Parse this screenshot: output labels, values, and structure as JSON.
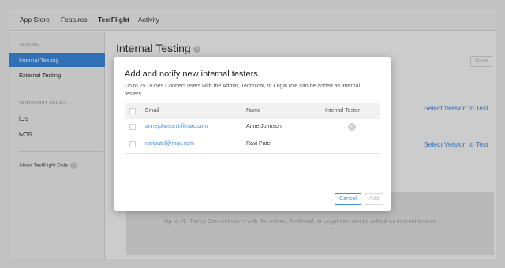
{
  "topnav": {
    "tabs": [
      "App Store",
      "Features",
      "TestFlight",
      "Activity"
    ],
    "active_tab": "TestFlight"
  },
  "sidebar": {
    "testing_header": "TESTING",
    "items": [
      "Internal Testing",
      "External Testing"
    ],
    "builds_header": "TESTFLIGHT BUILDS",
    "platforms": [
      "iOS",
      "tvOS"
    ],
    "about": "About TestFlight Data",
    "help_glyph": "?"
  },
  "main": {
    "title": "Internal Testing",
    "help_glyph": "?",
    "save_label": "Save",
    "select_version_ios": "Select Version to Test",
    "select_version_tvos": "Select Version to Test",
    "empty_message": "Up to 25 iTunes Connect users with the Admin, Technical, or Legal role can be added as internal testers."
  },
  "modal": {
    "title": "Add and notify new internal testers.",
    "description": "Up to 25 iTunes Connect users with the Admin, Technical, or Legal role can be added as internal testers.",
    "columns": {
      "email": "Email",
      "name": "Name",
      "internal_tester": "Internal Tester"
    },
    "rows": [
      {
        "email": "annejohnson1@mac.com",
        "name": "Anne Johnson",
        "internal_tester": true
      },
      {
        "email": "ravipatel@mac.com",
        "name": "Ravi Patel",
        "internal_tester": false
      }
    ],
    "cancel_label": "Cancel",
    "add_label": "Add"
  },
  "colors": {
    "accent": "#3d8ee4",
    "overlay": "rgba(0,0,0,0.2)"
  },
  "icons": {
    "help": "question-circle-icon",
    "tester_check": "check-circle-icon"
  }
}
